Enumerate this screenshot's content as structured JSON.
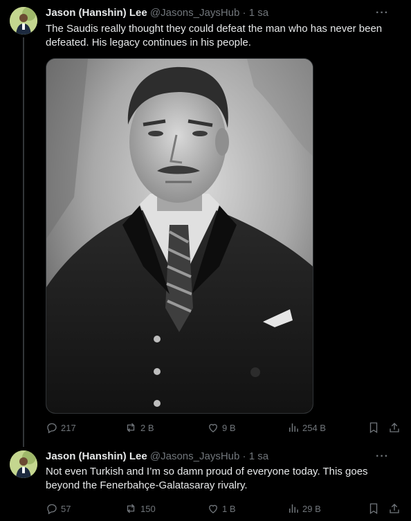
{
  "tweets": [
    {
      "name": "Jason (Hanshin) Lee",
      "handle": "@Jasons_JaysHub",
      "separator": "·",
      "time": "1 sa",
      "more": "···",
      "text_line1": "The Saudis really thought they could defeat the man who has never been",
      "text_line2": "defeated. His legacy continues in his people.",
      "replies": "217",
      "reposts": "2 B",
      "likes": "9 B",
      "views": "254 B"
    },
    {
      "name": "Jason (Hanshin) Lee",
      "handle": "@Jasons_JaysHub",
      "separator": "·",
      "time": "1 sa",
      "more": "···",
      "text_line1": "Not even Turkish and I’m so damn proud of everyone today. This goes",
      "text_line2": "beyond the Fenerbahçe-Galatasaray rivalry.",
      "replies": "57",
      "reposts": "150",
      "likes": "1 B",
      "views": "29 B"
    }
  ],
  "colors": {
    "background": "#000000",
    "text": "#e7e9ea",
    "muted": "#71767b",
    "border": "#2f3336"
  },
  "icons": [
    "reply-icon",
    "repost-icon",
    "like-icon",
    "views-icon",
    "bookmark-icon",
    "share-icon",
    "more-icon"
  ]
}
